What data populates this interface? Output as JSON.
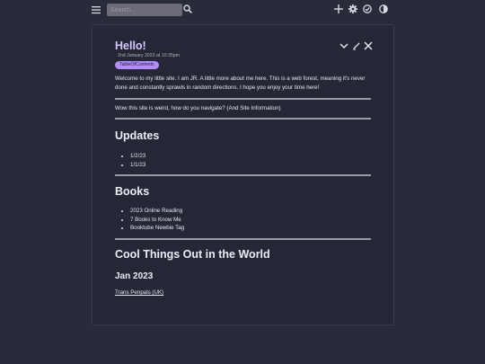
{
  "topbar": {
    "menu_icon": "hamburger-menu-icon",
    "search_placeholder": "Search...",
    "search_icon": "search-icon",
    "actions": [
      "plus-icon",
      "gear-icon",
      "check-circle-icon",
      "contrast-icon"
    ]
  },
  "card": {
    "title": "Hello!",
    "date": "2nd January 2023 at 10:35pm",
    "tag": "TableOfContents",
    "actions": [
      "chevron-down-icon",
      "edit-icon",
      "close-icon"
    ],
    "intro": "Welcome to my little site. I am JR. A little more about me here. This is a web forest, meaning it's never done and constantly sprawls in random directions. I hope you enjoy your time here!",
    "nav_note": "Wow this site is weird, how do you navigate? (And Site Information)",
    "updates": {
      "heading": "Updates",
      "items": [
        "1/2/23",
        "1/1/23"
      ]
    },
    "books": {
      "heading": "Books",
      "items": [
        "2023 Online Reading",
        "7 Books to Know Me",
        "Booktube Newbie Tag"
      ]
    },
    "cool": {
      "heading": "Cool Things Out in the World",
      "subheading": "Jan 2023",
      "link": "Trans Penpals (UK)"
    }
  },
  "colors": {
    "background": "#2a2b3a",
    "card": "#262736",
    "accent": "#b48cff",
    "title": "#d6c8ff"
  }
}
